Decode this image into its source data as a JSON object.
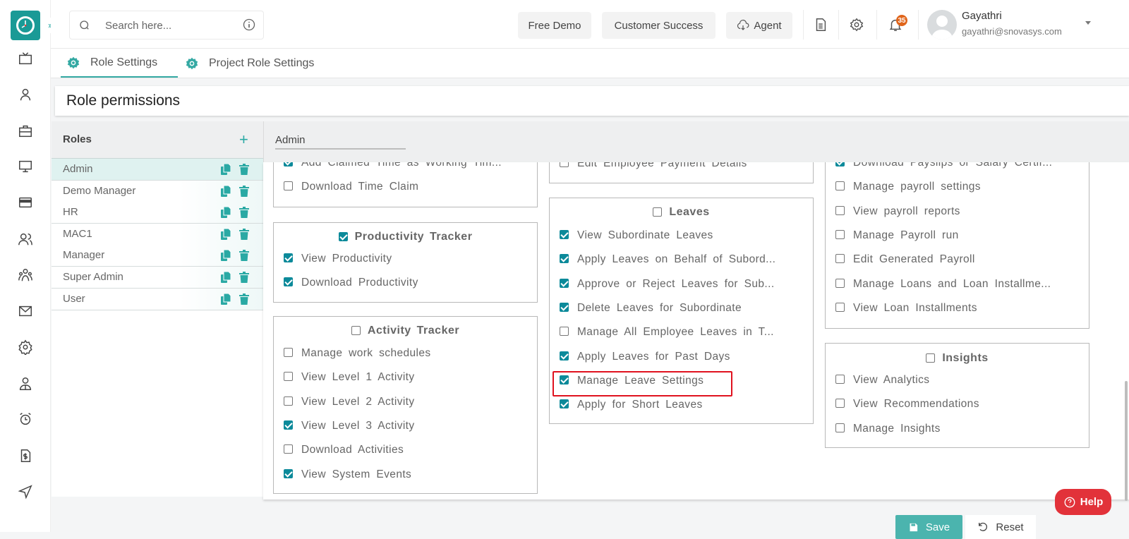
{
  "header": {
    "search_placeholder": "Search here...",
    "buttons": {
      "free_demo": "Free Demo",
      "customer_success": "Customer Success",
      "agent": "Agent"
    },
    "notification_count": "35",
    "user": {
      "name": "Gayathri",
      "email": "gayathri@snovasys.com"
    }
  },
  "tabs": [
    {
      "label": "Role Settings",
      "active": true
    },
    {
      "label": "Project Role Settings",
      "active": false
    }
  ],
  "page_title": "Role permissions",
  "roles_panel": {
    "title": "Roles",
    "add_icon": "plus-icon",
    "roles": [
      "Admin",
      "Demo Manager",
      "HR",
      "MAC1",
      "Manager",
      "Super Admin",
      "User"
    ],
    "selected": "Admin"
  },
  "role_name_value": "Admin",
  "permissions": {
    "col1": {
      "partial_group": [
        {
          "label": "Add Claimed Time as Working Tim...",
          "checked": true
        },
        {
          "label": "Download Time Claim",
          "checked": false
        }
      ],
      "productivity_tracker": {
        "title": "Productivity Tracker",
        "checked": true,
        "items": [
          {
            "label": "View Productivity",
            "checked": true
          },
          {
            "label": "Download Productivity",
            "checked": true
          }
        ]
      },
      "activity_tracker": {
        "title": "Activity Tracker",
        "checked": false,
        "items": [
          {
            "label": "Manage work schedules",
            "checked": false
          },
          {
            "label": "View Level 1 Activity",
            "checked": false
          },
          {
            "label": "View Level 2 Activity",
            "checked": false
          },
          {
            "label": "View Level 3 Activity",
            "checked": true
          },
          {
            "label": "Download Activities",
            "checked": false
          },
          {
            "label": "View System Events",
            "checked": true
          }
        ]
      }
    },
    "col2": {
      "partial_group": [
        {
          "label": "Edit Employee Payment Details",
          "checked": false
        }
      ],
      "leaves": {
        "title": "Leaves",
        "checked": false,
        "items": [
          {
            "label": "View Subordinate Leaves",
            "checked": true
          },
          {
            "label": "Apply Leaves on Behalf of Subord...",
            "checked": true
          },
          {
            "label": "Approve or Reject Leaves for Sub...",
            "checked": true
          },
          {
            "label": "Delete Leaves for Subordinate",
            "checked": true
          },
          {
            "label": "Manage All Employee Leaves in T...",
            "checked": false
          },
          {
            "label": "Apply Leaves for Past Days",
            "checked": true
          },
          {
            "label": "Manage Leave Settings",
            "checked": true
          },
          {
            "label": "Apply for Short Leaves",
            "checked": true
          }
        ]
      }
    },
    "col3": {
      "partial_group": [
        {
          "label": "Download Payslips or Salary Certif...",
          "checked": true
        },
        {
          "label": "Manage payroll settings",
          "checked": false
        },
        {
          "label": "View payroll reports",
          "checked": false
        },
        {
          "label": "Manage Payroll run",
          "checked": false
        },
        {
          "label": "Edit Generated Payroll",
          "checked": false
        },
        {
          "label": "Manage Loans and Loan Installme...",
          "checked": false
        },
        {
          "label": "View Loan Installments",
          "checked": false
        }
      ],
      "insights": {
        "title": "Insights",
        "checked": false,
        "items": [
          {
            "label": "View Analytics",
            "checked": false
          },
          {
            "label": "View Recommendations",
            "checked": false
          },
          {
            "label": "Manage Insights",
            "checked": false
          }
        ]
      }
    }
  },
  "highlighted_item": "Manage Leave Settings",
  "footer": {
    "save": "Save",
    "reset": "Reset",
    "help": "Help"
  },
  "colors": {
    "brand": "#1a9a96",
    "checkbox": "#0c8a9a",
    "help": "#e2323a",
    "highlight": "#e0121f",
    "save": "#4bb4ae"
  }
}
